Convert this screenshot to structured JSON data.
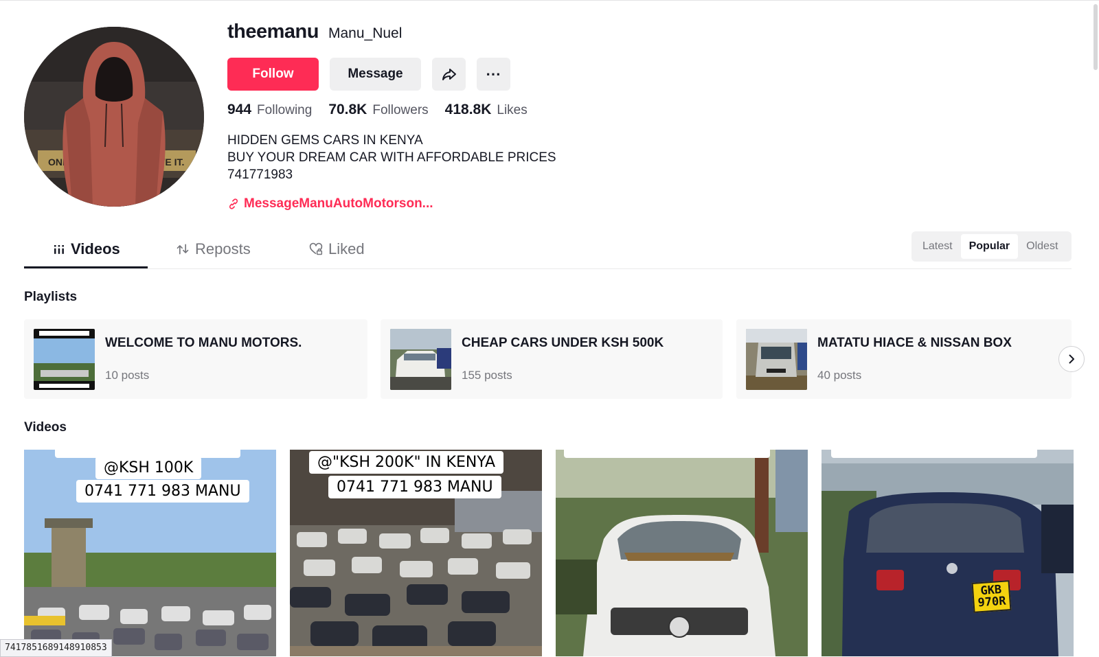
{
  "profile": {
    "username": "theemanu",
    "nickname": "Manu_Nuel",
    "follow_label": "Follow",
    "message_label": "Message",
    "stats": {
      "following_count": "944",
      "following_label": "Following",
      "followers_count": "70.8K",
      "followers_label": "Followers",
      "likes_count": "418.8K",
      "likes_label": "Likes"
    },
    "bio": [
      "HIDDEN GEMS CARS IN KENYA",
      "BUY YOUR DREAM CAR WITH AFFORDABLE PRICES",
      "741771983"
    ],
    "link_text": "MessageManuAutoMotorson..."
  },
  "tabs": [
    {
      "label": "Videos",
      "icon": "grid-icon",
      "active": true
    },
    {
      "label": "Reposts",
      "icon": "repost-icon",
      "active": false
    },
    {
      "label": "Liked",
      "icon": "heart-lock-icon",
      "active": false
    }
  ],
  "sort": {
    "latest": "Latest",
    "popular": "Popular",
    "oldest": "Oldest",
    "selected": "Popular"
  },
  "playlists_title": "Playlists",
  "playlists": [
    {
      "title": "WELCOME TO MANU MOTORS.",
      "count": "10 posts"
    },
    {
      "title": "CHEAP CARS UNDER KSH 500K",
      "count": "155 posts"
    },
    {
      "title": "MATATU HIACE & NISSAN BOX",
      "count": "40 posts"
    }
  ],
  "videos_title": "Videos",
  "videos": [
    {
      "caption1": "@KSH  100K",
      "caption2": "0741 771 983 MANU"
    },
    {
      "caption1": "@\"KSH 200K\" IN KENYA",
      "caption2": "0741 771 983 MANU"
    },
    {
      "caption1": "",
      "caption2": ""
    },
    {
      "plate": "GKB 970R"
    }
  ],
  "status_url": "7417851689148910853",
  "colors": {
    "accent": "#fe2c55",
    "text": "#161823",
    "muted": "#75767c"
  }
}
